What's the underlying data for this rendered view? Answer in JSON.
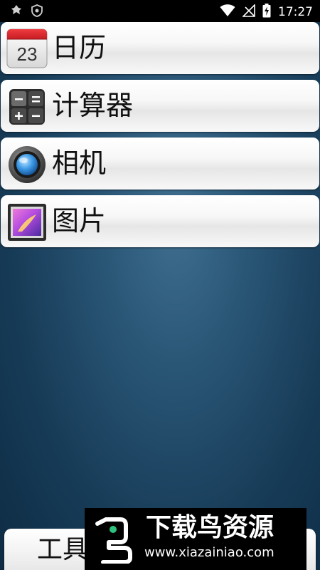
{
  "status_bar": {
    "time": "17:27",
    "left_icons": [
      "notification-icon",
      "shield-icon"
    ],
    "right_icons": [
      "wifi-icon",
      "no-signal-icon",
      "battery-charging-icon"
    ]
  },
  "apps": [
    {
      "label": "日历",
      "icon": "calendar-icon",
      "icon_text": "23"
    },
    {
      "label": "计算器",
      "icon": "calculator-icon"
    },
    {
      "label": "相机",
      "icon": "camera-icon"
    },
    {
      "label": "图片",
      "icon": "gallery-icon"
    }
  ],
  "toolbar": {
    "tools_label": "工具"
  },
  "watermark": {
    "title": "下载鸟资源",
    "url": "www.xiazainiao.com"
  },
  "colors": {
    "background_center": "#3f6f90",
    "background_edge": "#0e2b43",
    "calendar_red": "#d9252a"
  }
}
